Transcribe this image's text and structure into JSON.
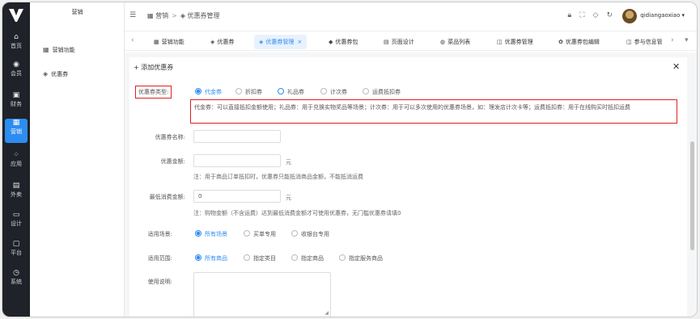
{
  "rail": {
    "items": [
      {
        "icon": "⌂",
        "label": "首页"
      },
      {
        "icon": "◉",
        "label": "会员"
      },
      {
        "icon": "▣",
        "label": "财务"
      },
      {
        "icon": "▦",
        "label": "营销"
      },
      {
        "icon": "⁘",
        "label": "应用"
      },
      {
        "icon": "▤",
        "label": "外卖"
      },
      {
        "icon": "▭",
        "label": "设计"
      },
      {
        "icon": "▢",
        "label": "平台"
      },
      {
        "icon": "◷",
        "label": "系统"
      }
    ]
  },
  "subnav": {
    "title": "营销",
    "items": [
      {
        "icon": "▦",
        "label": "营销功能"
      },
      {
        "icon": "◈",
        "label": "优惠券"
      }
    ]
  },
  "header": {
    "breadcrumb": [
      "营销",
      "优惠券管理"
    ],
    "username": "qidiangaoxiao"
  },
  "tabs": [
    {
      "icon": "▦",
      "label": "营销功能"
    },
    {
      "icon": "◈",
      "label": "优惠券"
    },
    {
      "icon": "◈",
      "label": "优惠券管理",
      "active": true
    },
    {
      "icon": "◆",
      "label": "优惠券包"
    },
    {
      "icon": "▤",
      "label": "页面设计"
    },
    {
      "icon": "◍",
      "label": "菜品列表"
    },
    {
      "icon": "◫",
      "label": "优惠券管理"
    },
    {
      "icon": "✿",
      "label": "优惠券包编辑"
    },
    {
      "icon": "◫",
      "label": "参与信息管"
    }
  ],
  "dialog": {
    "title": "+ 添加优惠券",
    "type_label": "优惠券类型:",
    "type_options": [
      "代金券",
      "折扣券",
      "礼品券",
      "计次券",
      "运费抵扣券"
    ],
    "type_selected": "代金券",
    "type_desc": "代金券：可以直接抵扣金额使用；礼品券：用于兑换实物奖品等场景；计次券：用于可以多次使用的优惠券场景，如：理发店计次卡等；运费抵扣券：用于在线购买时抵扣运费",
    "name_label": "优惠券名称:",
    "amount_label": "优惠金额:",
    "amount_unit": "元",
    "amount_note": "注：用于商品订单抵扣时，优惠券只能抵消商品金额，不能抵消运费",
    "min_label": "最低消费金额:",
    "min_value": "0",
    "min_unit": "元",
    "min_note": "注：购物金额（不含运费）达到最低消费金额才可使用优惠券，无门槛优惠券请填0",
    "scene_label": "适用场景:",
    "scene_options": [
      "所有场景",
      "买单专用",
      "收银台专用"
    ],
    "range_label": "适用范围:",
    "range_options": [
      "所有商品",
      "指定类目",
      "指定商品",
      "指定服务商品"
    ],
    "usage_label": "使用说明:"
  }
}
